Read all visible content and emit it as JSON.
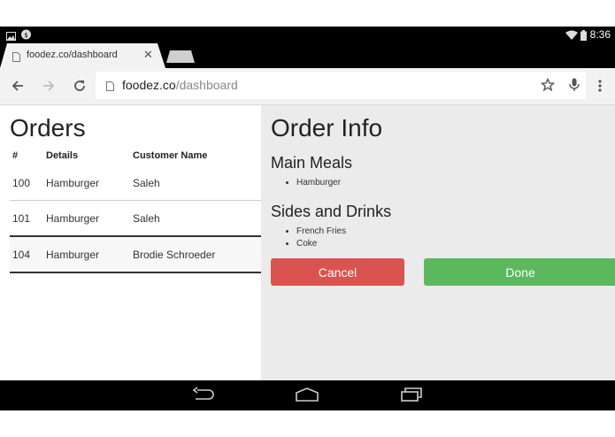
{
  "status_bar": {
    "time": "8:36",
    "icons": [
      "image-icon",
      "notification-icon",
      "wifi-icon",
      "battery-icon"
    ]
  },
  "browser": {
    "tab": {
      "title": "foodez.co/dashboard"
    },
    "omnibox": {
      "host": "foodez.co",
      "path": "/dashboard"
    }
  },
  "orders": {
    "title": "Orders",
    "columns": [
      "#",
      "Details",
      "Customer Name"
    ],
    "rows": [
      {
        "id": "100",
        "details": "Hamburger",
        "customer": "Saleh"
      },
      {
        "id": "101",
        "details": "Hamburger",
        "customer": "Saleh"
      },
      {
        "id": "104",
        "details": "Hamburger",
        "customer": "Brodie Schroeder"
      }
    ]
  },
  "order_info": {
    "title": "Order Info",
    "main_meals_title": "Main Meals",
    "main_meals": [
      "Hamburger"
    ],
    "sides_title": "Sides and Drinks",
    "sides": [
      "French Fries",
      "Coke"
    ],
    "cancel_label": "Cancel",
    "done_label": "Done"
  },
  "colors": {
    "cancel": "#d9534f",
    "done": "#5cb85c"
  }
}
